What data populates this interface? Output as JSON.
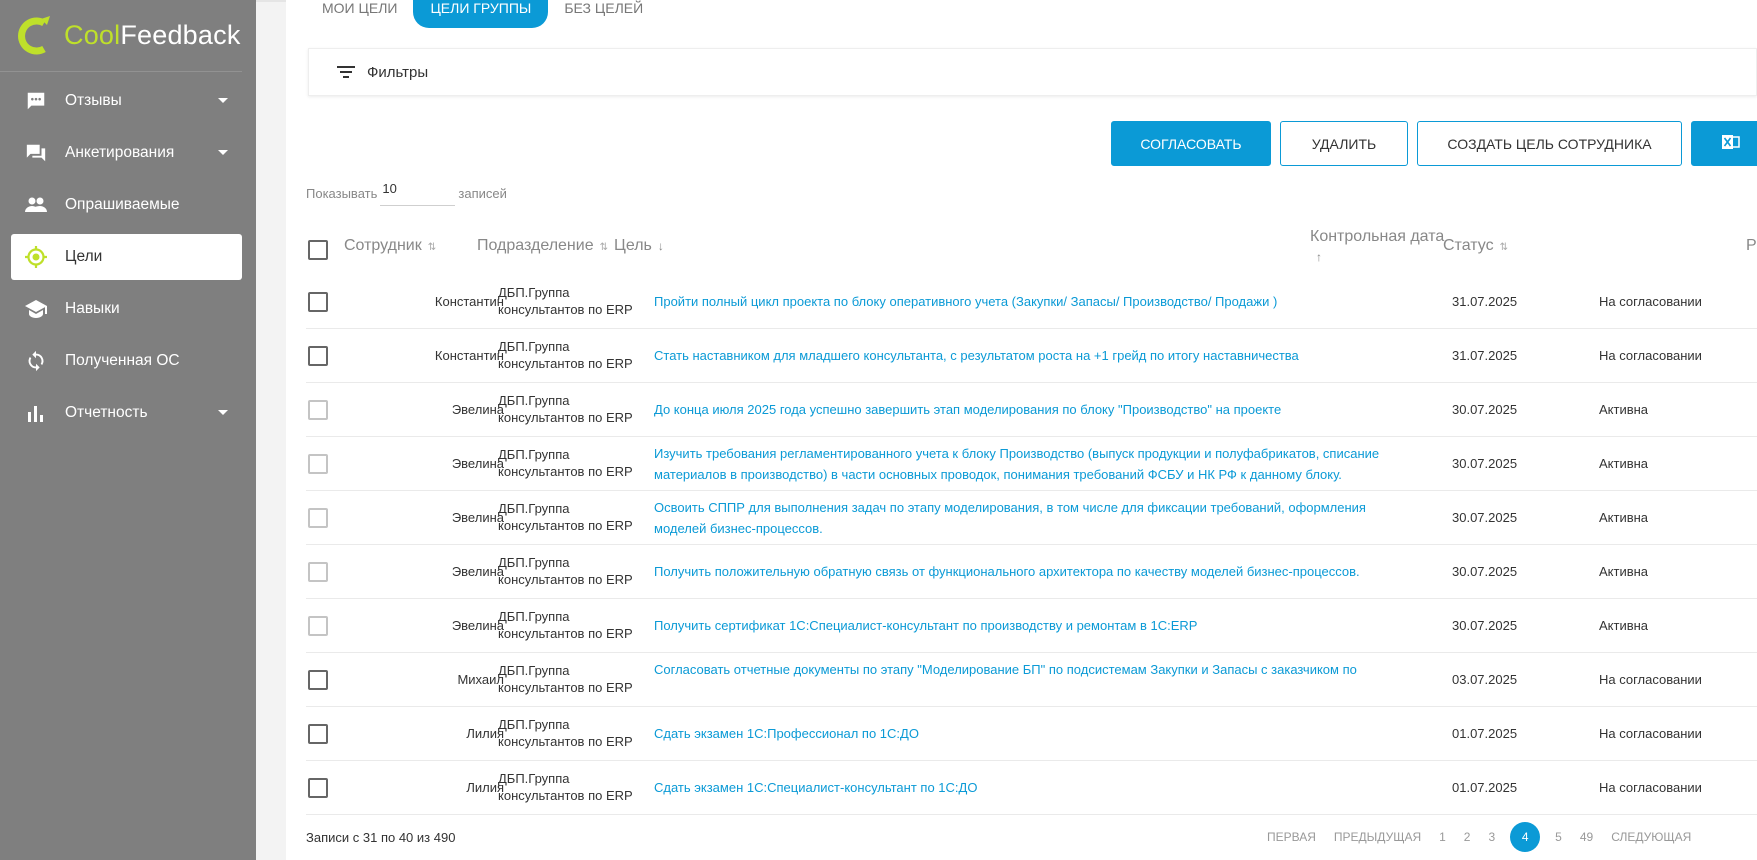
{
  "app": {
    "logo_part1": "Cool",
    "logo_part2": "Feedback",
    "accent": "#0b9ad6",
    "logo_green": "#bfe02a"
  },
  "sidebar": {
    "items": [
      {
        "label": "Отзывы",
        "icon": "chat-icon",
        "has_submenu": true
      },
      {
        "label": "Анкетирования",
        "icon": "forum-icon",
        "has_submenu": true
      },
      {
        "label": "Опрашиваемые",
        "icon": "people-icon",
        "has_submenu": false
      },
      {
        "label": "Цели",
        "icon": "target-icon",
        "has_submenu": false,
        "active": true
      },
      {
        "label": "Навыки",
        "icon": "school-icon",
        "has_submenu": false
      },
      {
        "label": "Полученная ОС",
        "icon": "sync-icon",
        "has_submenu": false
      },
      {
        "label": "Отчетность",
        "icon": "bar-chart-icon",
        "has_submenu": true
      }
    ]
  },
  "tabs": [
    {
      "label": "Мои цели"
    },
    {
      "label": "Цели группы",
      "active": true
    },
    {
      "label": "Без целей"
    }
  ],
  "filters": {
    "label": "Фильтры"
  },
  "actions": {
    "approve": "Согласовать",
    "delete": "Удалить",
    "create": "Создать цель сотрудника"
  },
  "pagesize": {
    "prefix": "Показывать",
    "value": "10",
    "suffix": "записей"
  },
  "table": {
    "headers": {
      "employee": "Сотрудник",
      "department": "Подразделение",
      "goal": "Цель",
      "date": "Контрольная дата",
      "status": "Статус"
    },
    "rows": [
      {
        "employee": "Константин",
        "department": "ДБП.Группа консультантов по ERP",
        "goal": "Пройти полный цикл проекта по блоку оперативного учета (Закупки/ Запасы/ Производство/ Продажи )",
        "date": "31.07.2025",
        "status": "На согласовании"
      },
      {
        "employee": "Константин",
        "department": "ДБП.Группа консультантов по ERP",
        "goal": "Стать наставником для младшего консультанта, с результатом роста на +1 грейд по итогу наставничества",
        "date": "31.07.2025",
        "status": "На согласовании"
      },
      {
        "employee": "Эвелина",
        "department": "ДБП.Группа консультантов по ERP",
        "goal": "До конца июля 2025 года успешно завершить этап моделирования по блоку \"Производство\" на проекте",
        "date": "30.07.2025",
        "status": "Активна"
      },
      {
        "employee": "Эвелина",
        "department": "ДБП.Группа консультантов по ERP",
        "goal": "Изучить требования регламентированного учета к блоку Производство (выпуск продукции и полуфабрикатов, списание материалов в производство) в части основных проводок, понимания требований ФСБУ и НК РФ к данному блоку.",
        "date": "30.07.2025",
        "status": "Активна"
      },
      {
        "employee": "Эвелина",
        "department": "ДБП.Группа консультантов по ERP",
        "goal": "Освоить СППР для выполнения задач по этапу моделирования, в том числе для фиксации требований, оформления моделей бизнес-процессов.",
        "date": "30.07.2025",
        "status": "Активна"
      },
      {
        "employee": "Эвелина",
        "department": "ДБП.Группа консультантов по ERP",
        "goal": "Получить положительную обратную связь от функционального архитектора по качеству моделей бизнес-процессов.",
        "date": "30.07.2025",
        "status": "Активна"
      },
      {
        "employee": "Эвелина",
        "department": "ДБП.Группа консультантов по ERP",
        "goal": "Получить сертификат 1С:Специалист-консультант по производству и ремонтам в 1С:ERP",
        "date": "30.07.2025",
        "status": "Активна"
      },
      {
        "employee": "Михаил",
        "department": "ДБП.Группа консультантов по ERP",
        "goal": "Согласовать отчетные документы по этапу \"Моделирование БП\"  по подсистемам Закупки и Запасы с заказчиком по",
        "date": "03.07.2025",
        "status": "На согласовании"
      },
      {
        "employee": "Лилия",
        "department": "ДБП.Группа консультантов по ERP",
        "goal": "Сдать экзамен 1С:Профессионал по 1С:ДО",
        "date": "01.07.2025",
        "status": "На согласовании"
      },
      {
        "employee": "Лилия",
        "department": "ДБП.Группа консультантов по ERP",
        "goal": "Сдать экзамен 1С:Специалист-консультант по 1С:ДО",
        "date": "01.07.2025",
        "status": "На согласовании"
      }
    ]
  },
  "footer": {
    "records_info": "Записи с 31 по 40 из 490"
  },
  "pagination": {
    "first": "Первая",
    "prev": "Предыдущая",
    "pages": [
      "1",
      "2",
      "3",
      "4",
      "5",
      "49"
    ],
    "current": "4",
    "next": "Следующая"
  }
}
